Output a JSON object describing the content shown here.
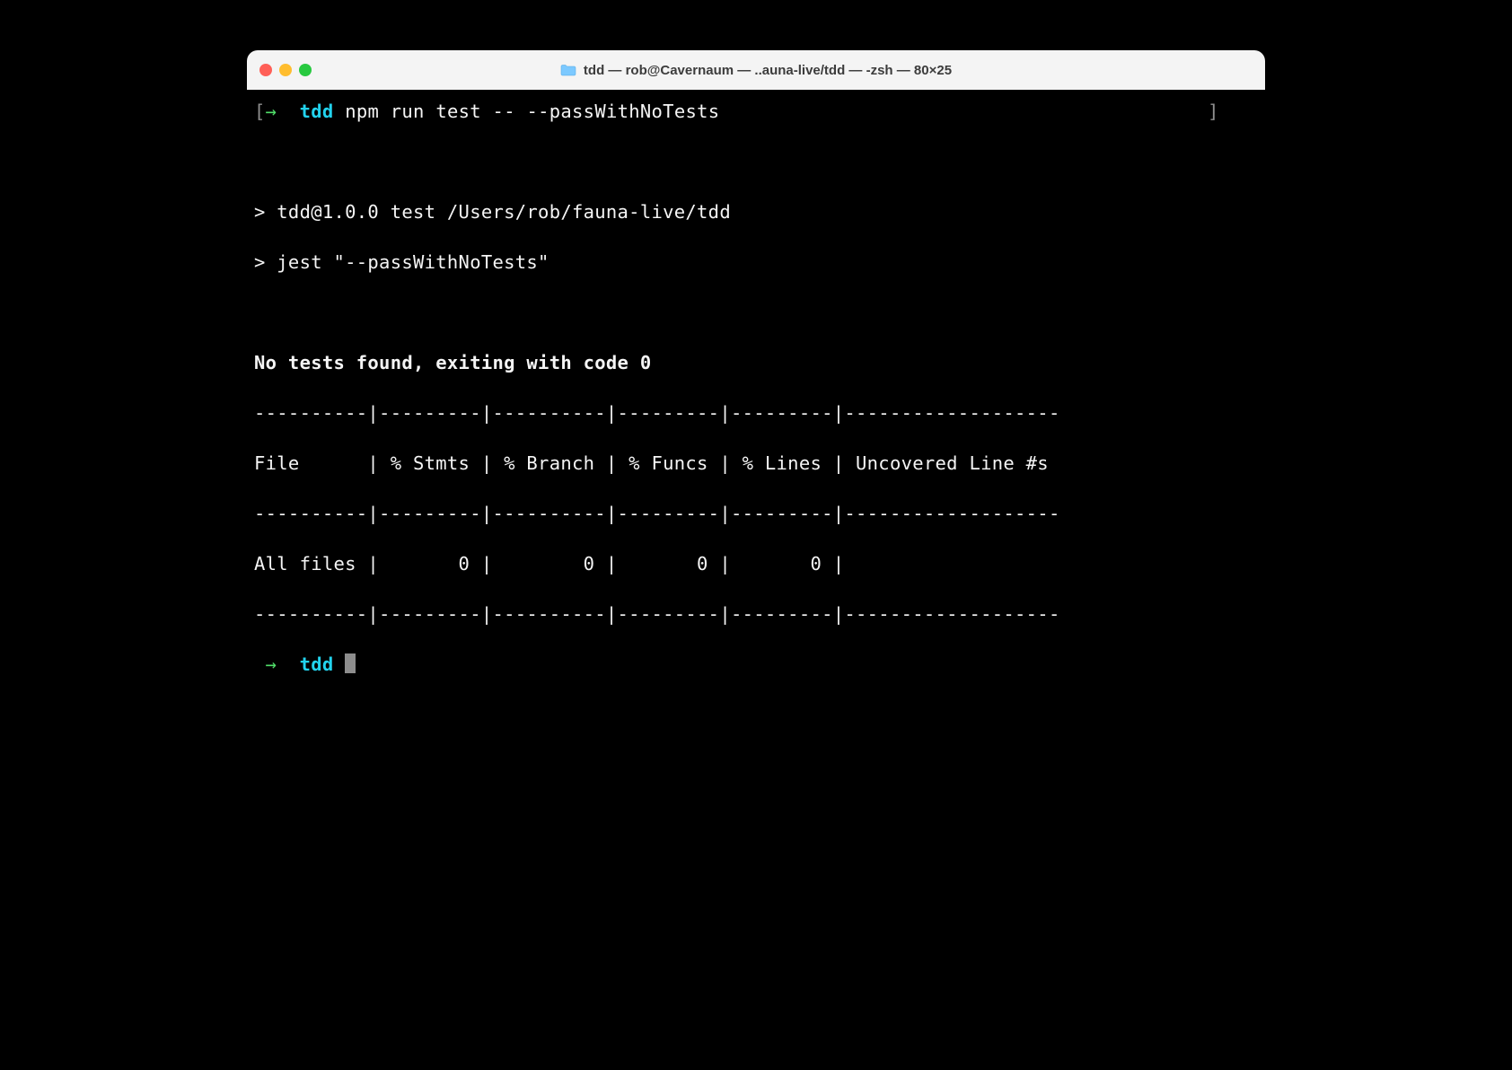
{
  "window": {
    "title": "tdd — rob@Cavernaum — ..auna-live/tdd — -zsh — 80×25"
  },
  "prompt1": {
    "lbracket": "[",
    "arrow": "→",
    "dir": "tdd",
    "command": "npm run test -- --passWithNoTests",
    "rbracket": "]"
  },
  "output": {
    "script_line1": "> tdd@1.0.0 test /Users/rob/fauna-live/tdd",
    "script_line2": "> jest \"--passWithNoTests\"",
    "no_tests": "No tests found, exiting with code 0",
    "table_border_top": "----------|---------|----------|---------|---------|-------------------",
    "table_header": "File      | % Stmts | % Branch | % Funcs | % Lines | Uncovered Line #s ",
    "table_border_mid": "----------|---------|----------|---------|---------|-------------------",
    "table_row": "All files |       0 |        0 |       0 |       0 |                   ",
    "table_border_bot": "----------|---------|----------|---------|---------|-------------------"
  },
  "prompt2": {
    "arrow": "→",
    "dir": "tdd"
  },
  "chart_data": {
    "type": "table",
    "title": "Jest coverage report",
    "columns": [
      "File",
      "% Stmts",
      "% Branch",
      "% Funcs",
      "% Lines",
      "Uncovered Line #s"
    ],
    "rows": [
      {
        "File": "All files",
        "% Stmts": 0,
        "% Branch": 0,
        "% Funcs": 0,
        "% Lines": 0,
        "Uncovered Line #s": ""
      }
    ]
  }
}
